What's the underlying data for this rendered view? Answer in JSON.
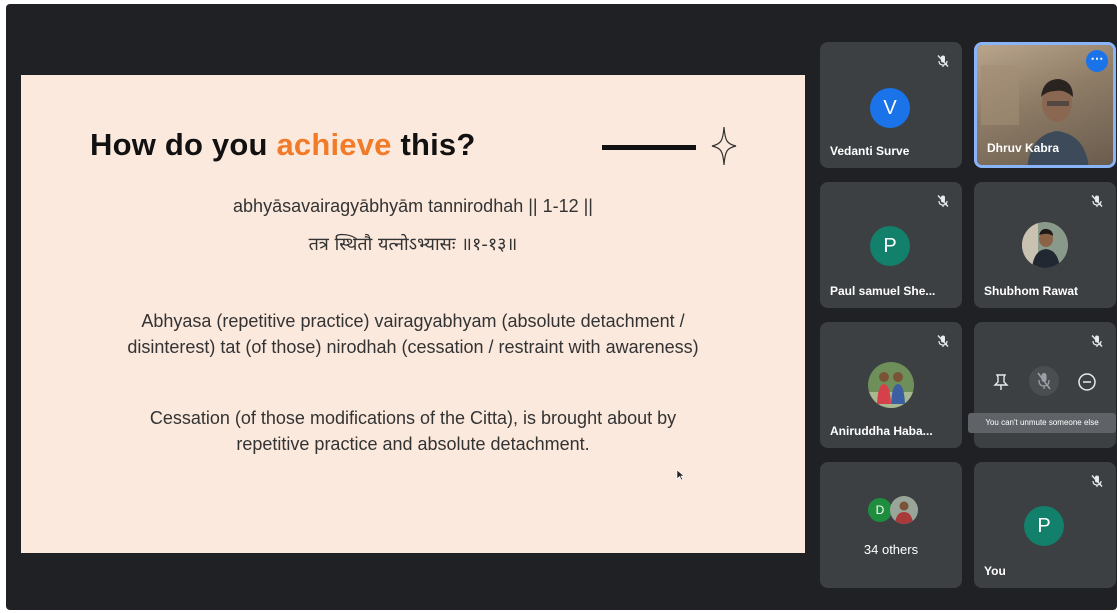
{
  "slide": {
    "title_pre": "How do you ",
    "title_accent": "achieve",
    "title_post": " this?",
    "sutra_line": "abhyāsavairagyābhyām tannirodhah || 1-12 ||",
    "sanskrit_line": "तत्र स्थितौ यत्नोऽभ्यासः ॥१-१३॥",
    "paragraph1_line1": "Abhyasa (repetitive practice) vairagyabhyam (absolute detachment /",
    "paragraph1_line2": "disinterest) tat (of those) nirodhah (cessation / restraint with awareness)",
    "paragraph2_line1": "Cessation (of those modifications of the Citta), is brought about by",
    "paragraph2_line2": "repetitive practice and absolute detachment."
  },
  "participants": {
    "vedanti": {
      "initial": "V",
      "name": "Vedanti Surve",
      "color": "#1a73e8"
    },
    "dhruv": {
      "name": "Dhruv Kabra",
      "more": "⋯"
    },
    "paul": {
      "initial": "P",
      "name": "Paul samuel She...",
      "color": "#12806a"
    },
    "shubhom": {
      "name": "Shubhom Rawat"
    },
    "aniruddha": {
      "name": "Aniruddha Haba..."
    },
    "hovered": {
      "tooltip": "You can't unmute someone else"
    },
    "others": {
      "initial": "D",
      "label": "34 others",
      "color": "#1e8e3e"
    },
    "you": {
      "initial": "P",
      "name": "You",
      "color": "#12806a"
    }
  },
  "icons": {
    "mic_off": "mic-off-icon",
    "pin": "pin-icon",
    "remove": "remove-icon",
    "sparkle": "sparkle-icon"
  }
}
